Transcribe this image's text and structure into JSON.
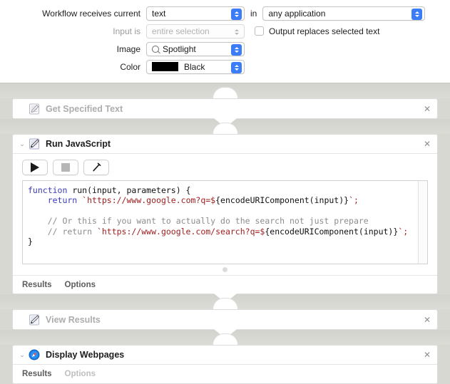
{
  "settings": {
    "rows": [
      {
        "label": "Workflow receives current",
        "value": "text",
        "disabled": false,
        "connector": "in",
        "second_value": "any application",
        "second_disabled": false
      },
      {
        "label": "Input is",
        "value": "entire selection",
        "disabled": true,
        "checkbox_label": "Output replaces selected text",
        "checkbox_checked": false
      },
      {
        "label": "Image",
        "value": "Spotlight",
        "disabled": false,
        "icon": "search-icon"
      },
      {
        "label": "Color",
        "value": "Black",
        "disabled": false,
        "swatch": "#000000"
      }
    ]
  },
  "workflow": {
    "actions": [
      {
        "title": "Get Specified Text",
        "icon": "notepad-pencil-icon",
        "state": "collapsed",
        "dimmed": true,
        "close_label": "✕"
      },
      {
        "title": "Run JavaScript",
        "icon": "script-pen-icon",
        "state": "expanded",
        "dimmed": false,
        "close_label": "✕",
        "toolbar": [
          {
            "name": "run-button",
            "icon": "play-icon"
          },
          {
            "name": "stop-button",
            "icon": "stop-icon"
          },
          {
            "name": "build-button",
            "icon": "hammer-icon"
          }
        ],
        "code_lines": [
          [
            {
              "t": "function",
              "c": "kw"
            },
            {
              "t": " run(input, parameters) {",
              "c": "pun"
            }
          ],
          [
            {
              "t": "    return",
              "c": "kw"
            },
            {
              "t": " `https://www.google.com?q=$",
              "c": "str"
            },
            {
              "t": "{encodeURIComponent(input)}",
              "c": "pun"
            },
            {
              "t": "`;",
              "c": "str"
            }
          ],
          [],
          [
            {
              "t": "    // Or this if you want to actually do the search not just prepare",
              "c": "cmt"
            }
          ],
          [
            {
              "t": "    // return ",
              "c": "cmt"
            },
            {
              "t": "`https://www.google.com/search?q=$",
              "c": "str"
            },
            {
              "t": "{encodeURIComponent(input)}",
              "c": "pun"
            },
            {
              "t": "`;",
              "c": "str"
            }
          ],
          [
            {
              "t": "}",
              "c": "pun"
            }
          ]
        ],
        "footer": [
          {
            "label": "Results",
            "dimmed": false
          },
          {
            "label": "Options",
            "dimmed": false
          }
        ]
      },
      {
        "title": "View Results",
        "icon": "script-pen-icon",
        "state": "collapsed",
        "dimmed": true,
        "close_label": "✕"
      },
      {
        "title": "Display Webpages",
        "icon": "compass-icon",
        "state": "expanded",
        "dimmed": false,
        "close_label": "✕",
        "footer": [
          {
            "label": "Results",
            "dimmed": false
          },
          {
            "label": "Options",
            "dimmed": true
          }
        ]
      }
    ],
    "chevron_glyph": "⌄"
  },
  "colors": {
    "accent": "#3b7df6",
    "canvas": "#d8d8d2",
    "card": "#ffffff",
    "keyword": "#3b3bb8",
    "string": "#a02020",
    "comment": "#8d8d8d"
  }
}
